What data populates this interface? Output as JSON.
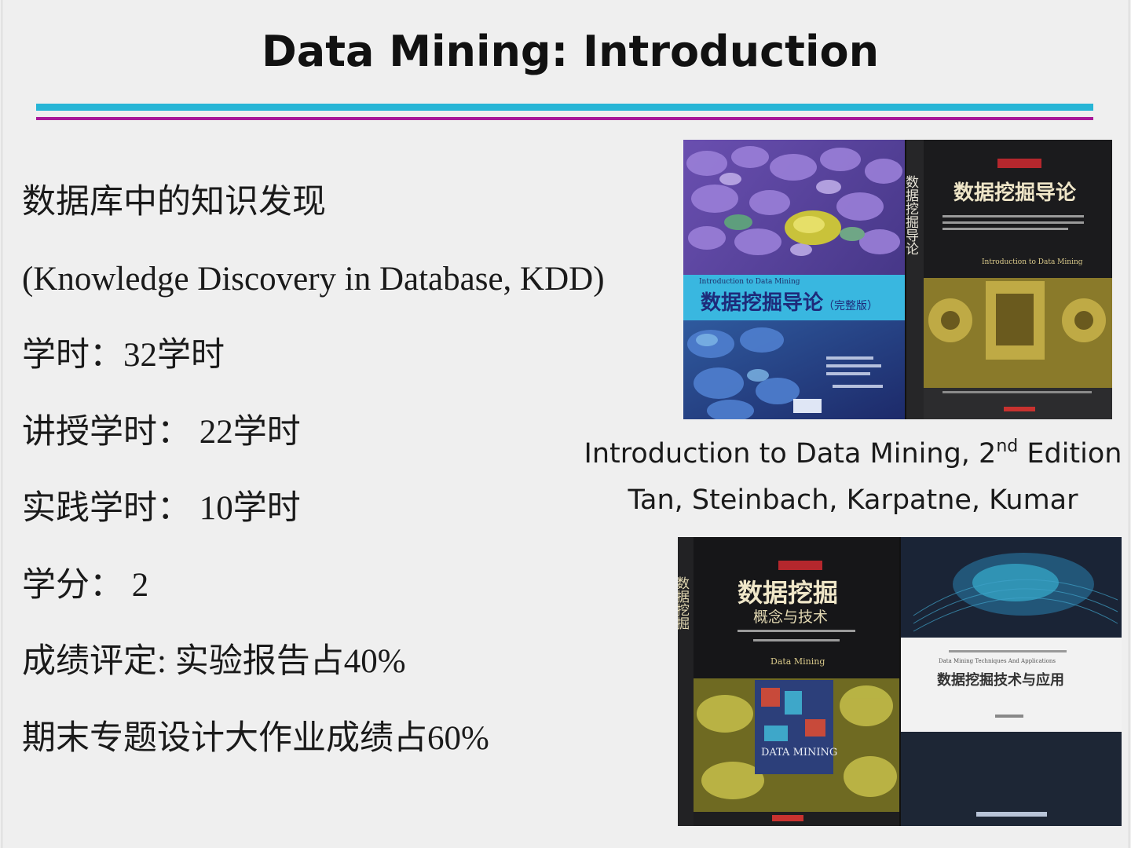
{
  "slide": {
    "title": "Data Mining: Introduction",
    "colors": {
      "rule_top": "#27b5d6",
      "rule_bottom": "#a8189a"
    }
  },
  "bullets": [
    "数据库中的知识发现",
    "(Knowledge Discovery in Database, KDD)",
    "学时：32学时",
    "讲授学时：  22学时",
    "实践学时：  10学时",
    "学分：  2",
    "成绩评定: 实验报告占40%",
    "期末专题设计大作业成绩占60%"
  ],
  "caption": {
    "line1_before": "Introduction to Data Mining, 2",
    "line1_sup": "nd",
    "line1_after": " Edition",
    "line2": "Tan, Steinbach, Karpatne, Kumar"
  },
  "books": {
    "cover1_title": "数据挖掘导论",
    "cover1_edition": "（完整版）",
    "cover1_en": "Introduction to Data Mining",
    "cover2_title": "数据挖掘导论",
    "cover2_spine": "数据挖掘导论",
    "cover2_en": "Introduction to Data Mining",
    "cover3_title": "数据挖掘",
    "cover3_subtitle": "概念与技术",
    "cover3_spine": "数据挖掘",
    "cover3_en": "Data Mining",
    "cover3_inset": "DATA MINING",
    "cover4_title": "数据挖掘技术与应用",
    "cover4_en": "Data Mining Techniques And Applications"
  }
}
